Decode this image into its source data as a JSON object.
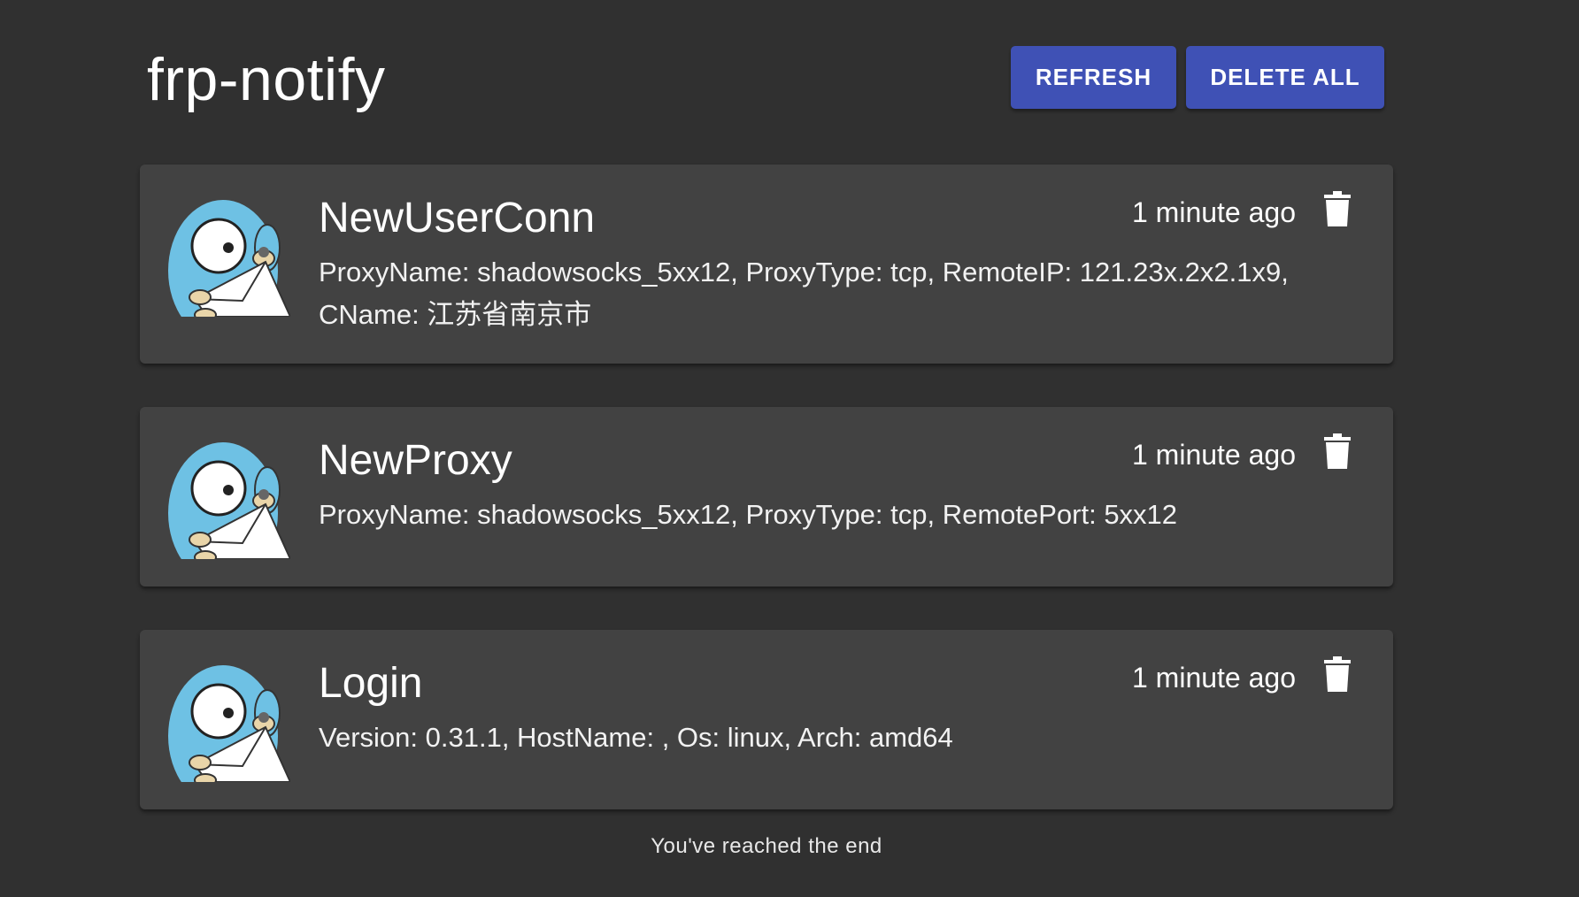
{
  "app": {
    "title": "frp-notify",
    "refresh_label": "REFRESH",
    "delete_all_label": "DELETE ALL"
  },
  "notifications": [
    {
      "title": "NewUserConn",
      "time": "1 minute ago",
      "body": "ProxyName: shadowsocks_5xx12, ProxyType: tcp, RemoteIP: 121.23x.2x2.1x9, CName: 江苏省南京市",
      "icon": "gopher-mail-icon"
    },
    {
      "title": "NewProxy",
      "time": "1 minute ago",
      "body": "ProxyName: shadowsocks_5xx12, ProxyType: tcp, RemotePort: 5xx12",
      "icon": "gopher-mail-icon"
    },
    {
      "title": "Login",
      "time": "1 minute ago",
      "body": "Version: 0.31.1, HostName: , Os: linux, Arch: amd64",
      "icon": "gopher-mail-icon"
    }
  ],
  "footer": {
    "end_text": "You've reached the end"
  },
  "colors": {
    "background": "#303030",
    "card": "#424242",
    "primary": "#3f51b5",
    "gopher": "#6ec1e4"
  }
}
